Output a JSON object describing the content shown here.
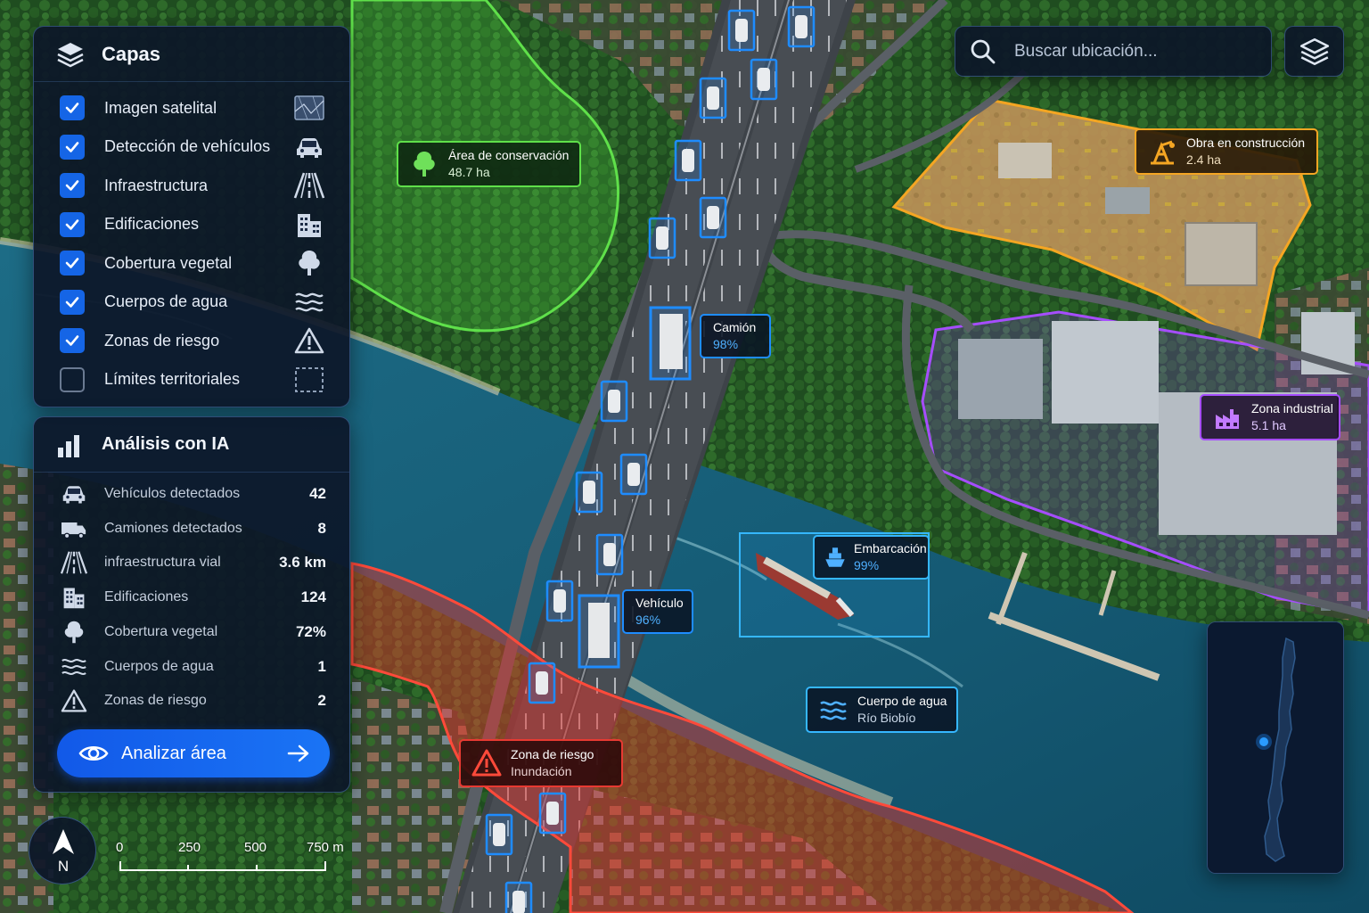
{
  "layers_panel": {
    "title": "Capas",
    "items": [
      {
        "label": "Imagen satelital",
        "checked": true,
        "icon": "satellite-image-icon"
      },
      {
        "label": "Detección de vehículos",
        "checked": true,
        "icon": "car-icon"
      },
      {
        "label": "Infraestructura",
        "checked": true,
        "icon": "road-icon"
      },
      {
        "label": "Edificaciones",
        "checked": true,
        "icon": "building-icon"
      },
      {
        "label": "Cobertura vegetal",
        "checked": true,
        "icon": "tree-icon"
      },
      {
        "label": "Cuerpos de agua",
        "checked": true,
        "icon": "water-waves-icon"
      },
      {
        "label": "Zonas de riesgo",
        "checked": true,
        "icon": "warning-triangle-icon"
      },
      {
        "label": "Límites territoriales",
        "checked": false,
        "icon": "dashed-boundary-icon"
      }
    ]
  },
  "analysis_panel": {
    "title": "Análisis con IA",
    "stats": [
      {
        "label": "Vehículos detectados",
        "value": "42",
        "icon": "car-icon"
      },
      {
        "label": "Camiones detectados",
        "value": "8",
        "icon": "truck-icon"
      },
      {
        "label": "infraestructura vial",
        "value": "3.6 km",
        "icon": "road-icon"
      },
      {
        "label": "Edificaciones",
        "value": "124",
        "icon": "building-icon"
      },
      {
        "label": "Cobertura vegetal",
        "value": "72%",
        "icon": "tree-icon"
      },
      {
        "label": "Cuerpos de agua",
        "value": "1",
        "icon": "water-waves-icon"
      },
      {
        "label": "Zonas de riesgo",
        "value": "2",
        "icon": "warning-triangle-icon"
      }
    ],
    "analyze_button_label": "Analizar área"
  },
  "search": {
    "placeholder": "Buscar ubicación..."
  },
  "callouts": {
    "conservation": {
      "title": "Área de conservación",
      "sub": "48.7 ha"
    },
    "construction": {
      "title": "Obra en construcción",
      "sub": "2.4 ha"
    },
    "industrial": {
      "title": "Zona industrial",
      "sub": "5.1 ha"
    },
    "truck": {
      "title": "Camión",
      "sub": "98%"
    },
    "vessel": {
      "title": "Embarcación",
      "sub": "99%"
    },
    "vehicle": {
      "title": "Vehículo",
      "sub": "96%"
    },
    "water": {
      "title": "Cuerpo de agua",
      "sub": "Río Biobío"
    },
    "risk": {
      "title": "Zona de riesgo",
      "sub": "Inundación"
    }
  },
  "compass": {
    "label": "N"
  },
  "scale": {
    "ticks": [
      "0",
      "250",
      "500",
      "750 m"
    ]
  },
  "colors": {
    "accent": "#1565e6",
    "conservation": "#5fe04a",
    "construction": "#f5a623",
    "industrial": "#a64dff",
    "risk": "#e83a32",
    "detection": "#1e8cff",
    "water_label": "#4fb0ff"
  }
}
